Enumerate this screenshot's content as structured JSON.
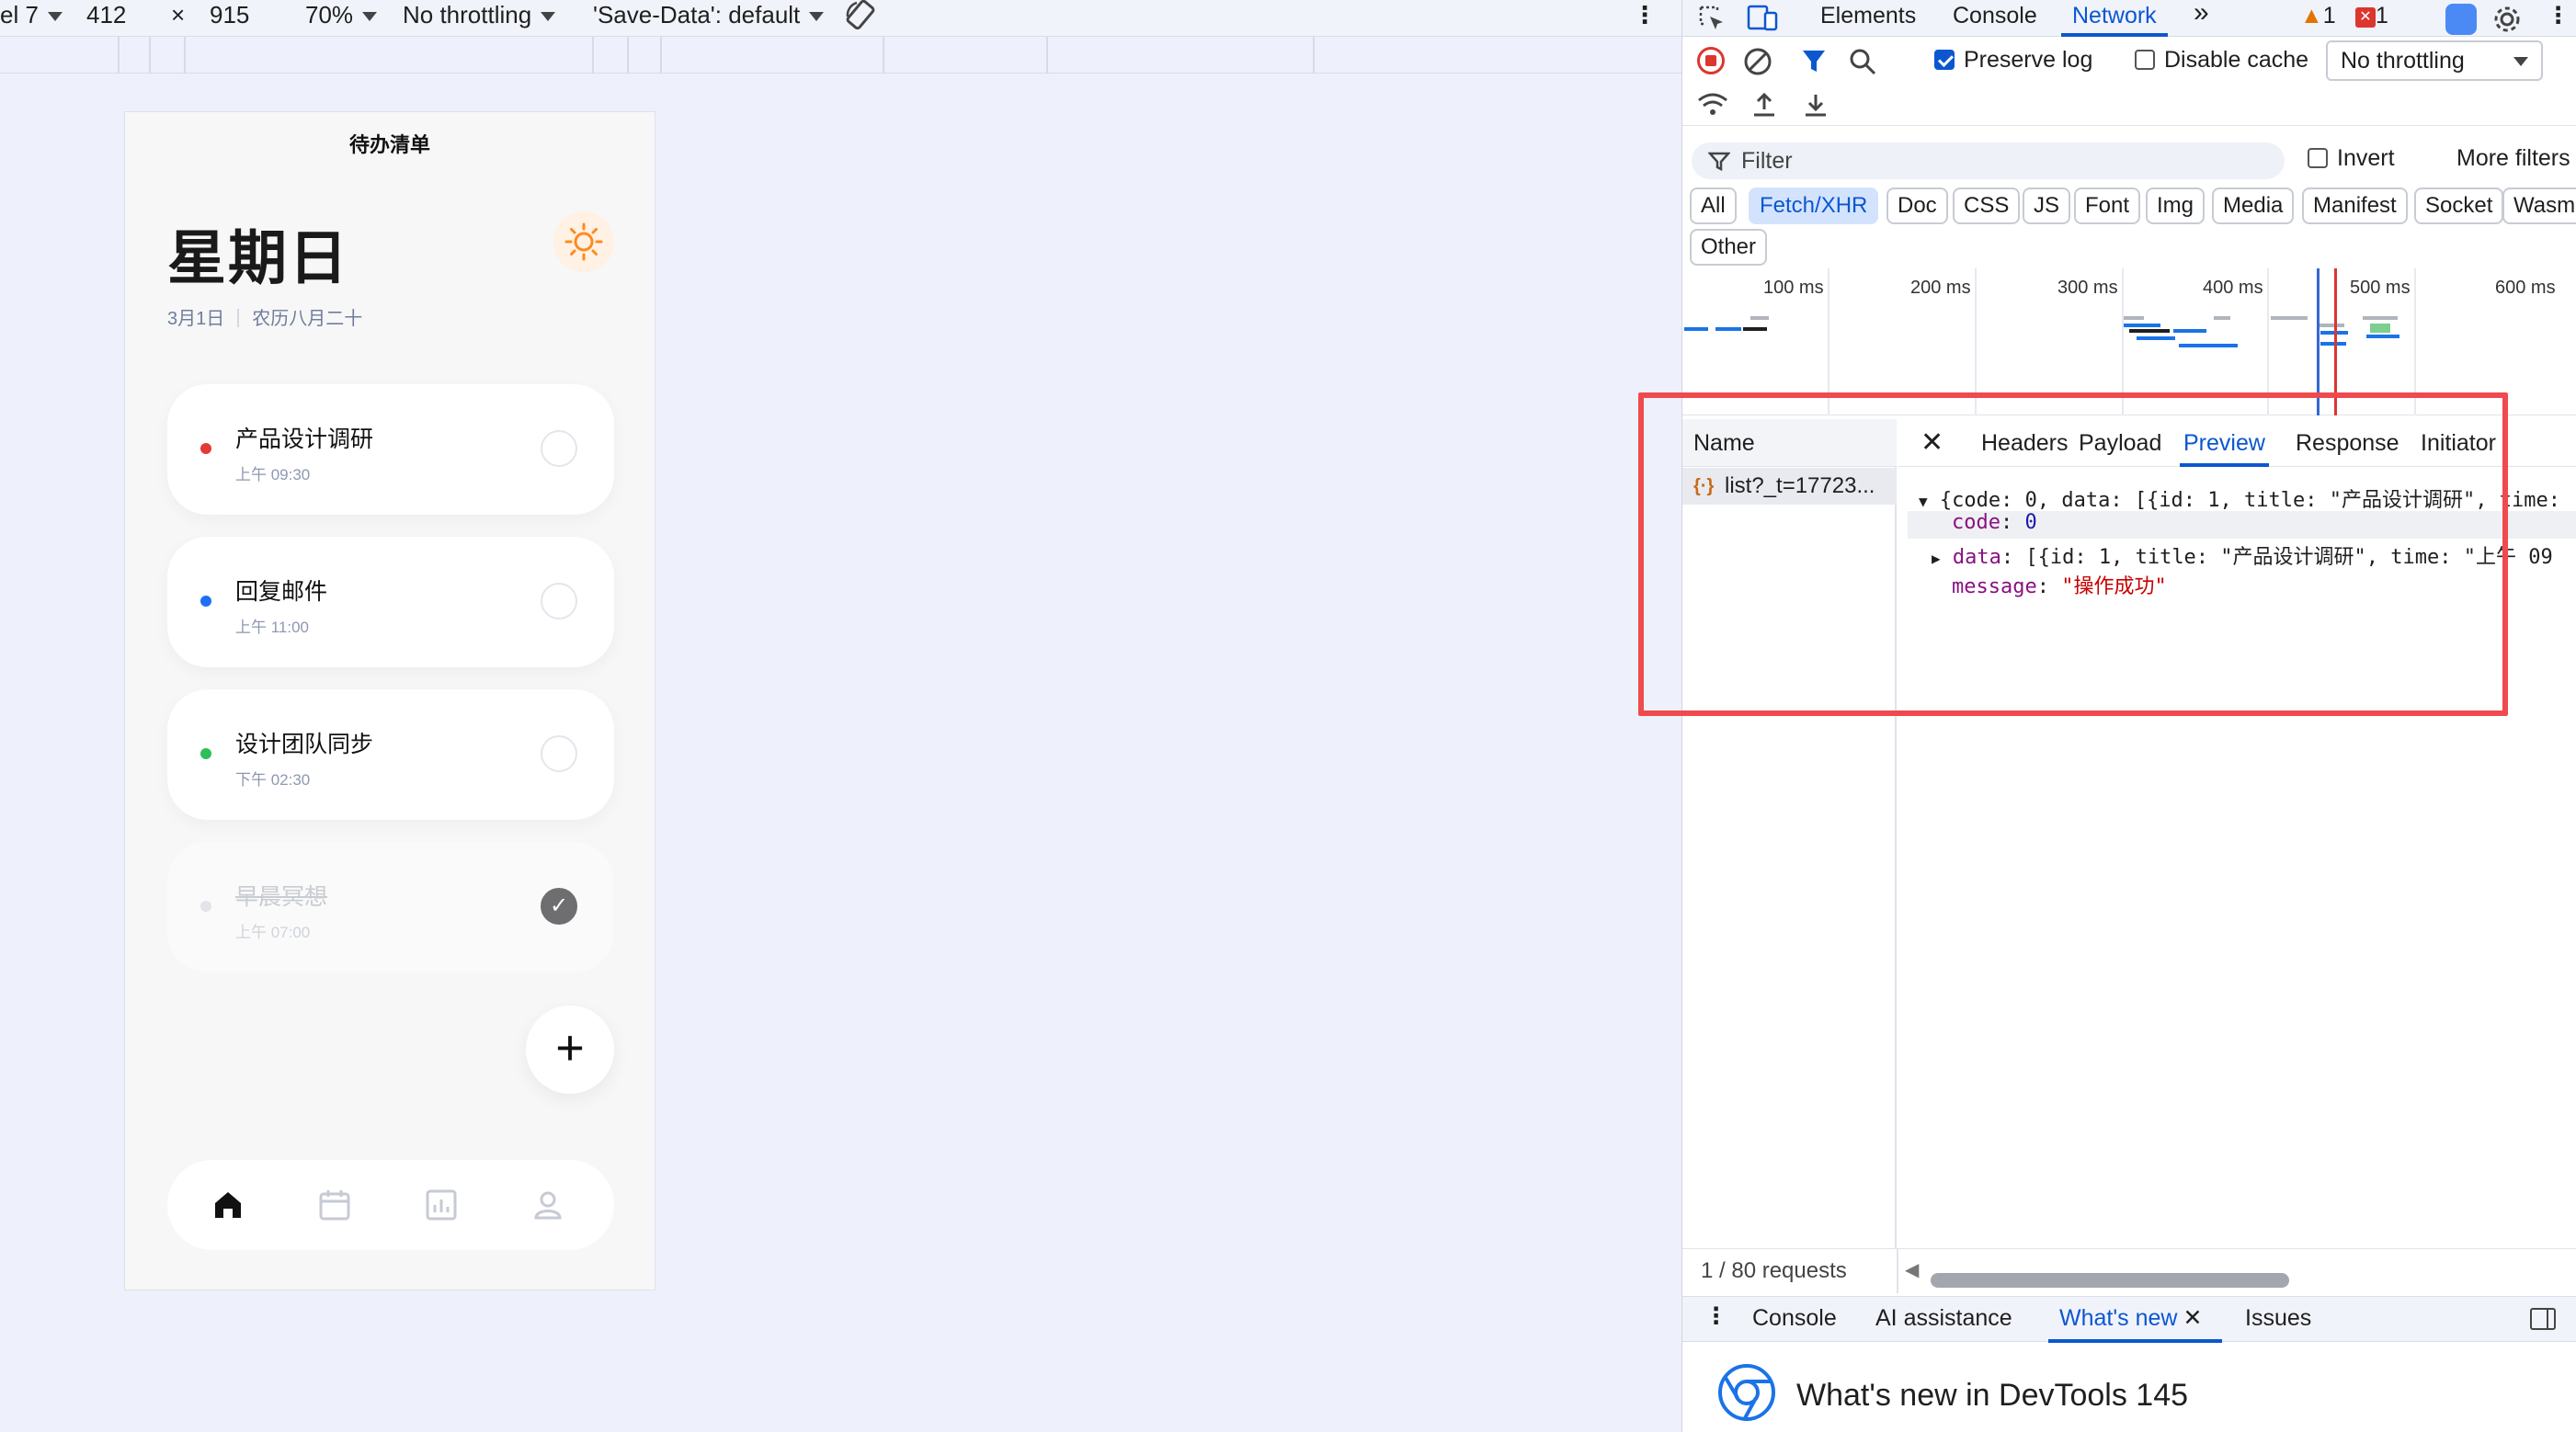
{
  "device_toolbar": {
    "device": "el 7",
    "width": "412",
    "times": "×",
    "height": "915",
    "zoom": "70%",
    "throttling": "No throttling",
    "save_data": "'Save-Data': default"
  },
  "app": {
    "title": "待办清单",
    "weekday": "星期日",
    "date": "3月1日",
    "lunar": "农历八月二十",
    "tasks": [
      {
        "title": "产品设计调研",
        "time": "上午 09:30",
        "color": "#e53935",
        "done": false
      },
      {
        "title": "回复邮件",
        "time": "上午 11:00",
        "color": "#1e6ff1",
        "done": false
      },
      {
        "title": "设计团队同步",
        "time": "下午 02:30",
        "color": "#2fbf5b",
        "done": false
      },
      {
        "title": "早晨冥想",
        "time": "上午 07:00",
        "color": "#e2e4e8",
        "done": true
      }
    ],
    "check_glyph": "✓",
    "add_glyph": "+",
    "nav": [
      "home-icon",
      "calendar-icon",
      "stats-icon",
      "profile-icon"
    ]
  },
  "devtools": {
    "tabs": [
      "Elements",
      "Console",
      "Network"
    ],
    "more": "»",
    "warnings": "1",
    "errors": "1",
    "preserve_log": "Preserve log",
    "disable_cache": "Disable cache",
    "throttling": "No throttling",
    "filter_placeholder": "Filter",
    "invert": "Invert",
    "more_filters": "More filters",
    "types": [
      "All",
      "Fetch/XHR",
      "Doc",
      "CSS",
      "JS",
      "Font",
      "Img",
      "Media",
      "Manifest",
      "Socket",
      "Wasm",
      "Other"
    ],
    "active_type": "Fetch/XHR",
    "timeline_labels": [
      "100 ms",
      "200 ms",
      "300 ms",
      "400 ms",
      "500 ms",
      "600 ms"
    ],
    "name_header": "Name",
    "request_name": "list?_t=17723...",
    "detail_tabs": [
      "Headers",
      "Payload",
      "Preview",
      "Response",
      "Initiator"
    ],
    "active_detail_tab": "Preview",
    "preview": {
      "line1": "{code: 0, data: [{id: 1, title: \"产品设计调研\", time:",
      "code_key": "code",
      "code_val": "0",
      "data_key": "data",
      "data_val": "[{id: 1, title: \"产品设计调研\", time: \"上午 09",
      "message_key": "message",
      "message_val": "\"操作成功\""
    },
    "requests_count": "1 / 80 requests",
    "drawer_tabs": [
      "Console",
      "AI assistance",
      "What's new",
      "Issues"
    ],
    "whats_new_title": "What's new in DevTools 145"
  }
}
